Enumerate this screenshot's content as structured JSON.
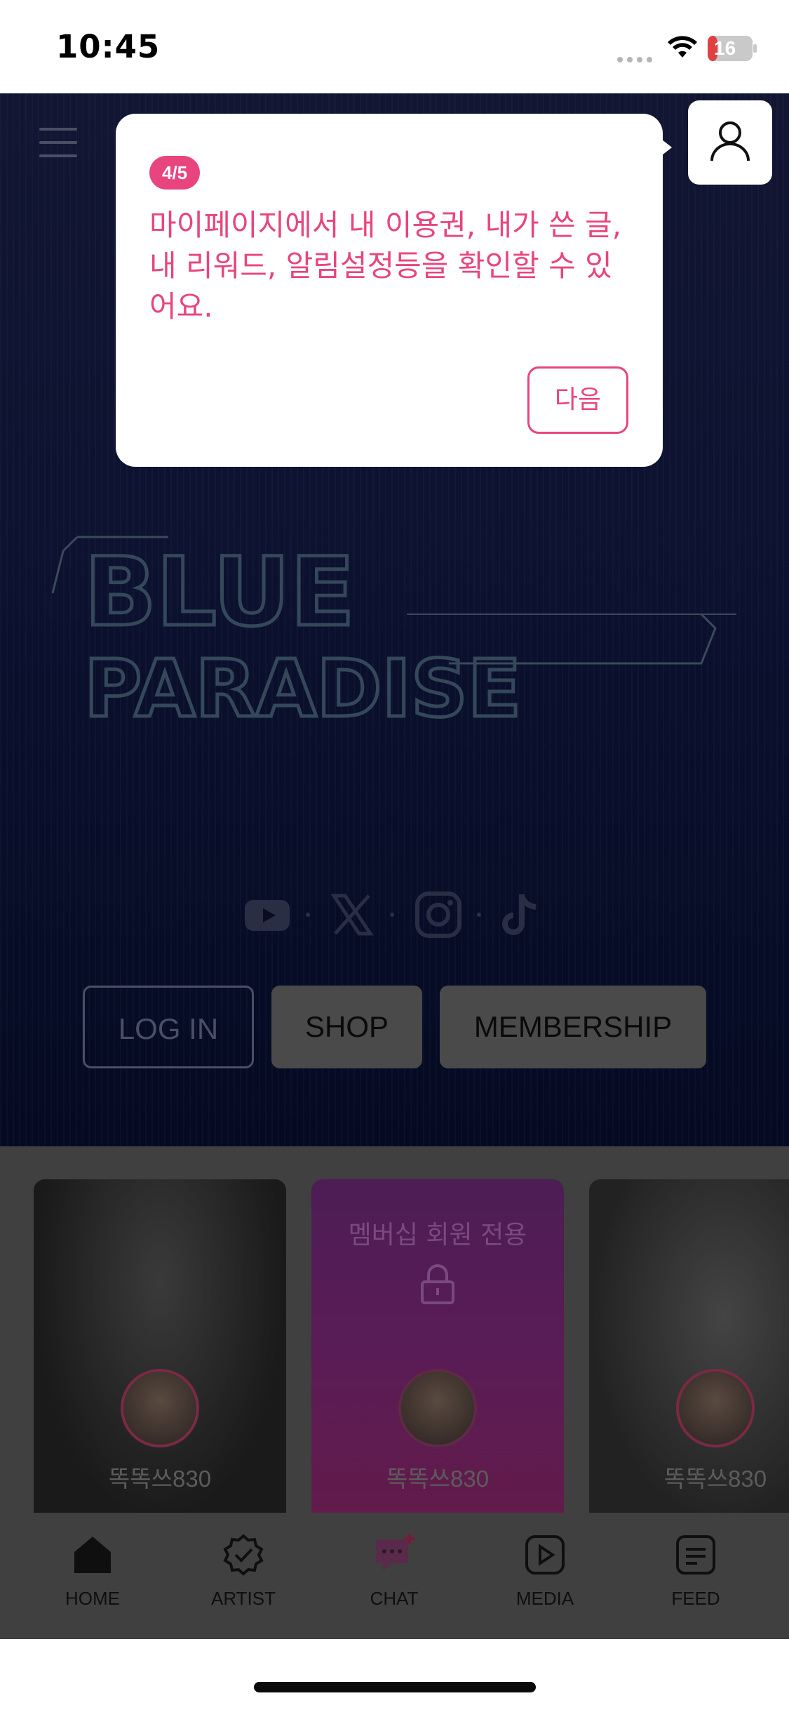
{
  "status_bar": {
    "time": "10:45",
    "battery": "16"
  },
  "tooltip": {
    "step": "4/5",
    "message": "마이페이지에서 내 이용권, 내가 쓴 글, 내 리워드, 알림설정등을 확인할 수 있어요.",
    "next_label": "다음"
  },
  "hero": {
    "logo_line1": "BLUE",
    "logo_line2": "PARADISE",
    "social_icons": [
      "youtube-icon",
      "x-icon",
      "instagram-icon",
      "tiktok-icon"
    ],
    "buttons": {
      "login": "LOG IN",
      "shop": "SHOP",
      "membership": "MEMBERSHIP"
    }
  },
  "cards": [
    {
      "name": "똑똑쓰830",
      "locked": false
    },
    {
      "name": "똑똑쓰830",
      "locked": true,
      "lock_label": "멤버십 회원 전용"
    },
    {
      "name": "똑똑쓰830",
      "locked": false
    }
  ],
  "tabs": [
    {
      "label": "HOME",
      "icon": "home-icon"
    },
    {
      "label": "ARTIST",
      "icon": "verified-badge-icon"
    },
    {
      "label": "CHAT",
      "icon": "chat-icon"
    },
    {
      "label": "MEDIA",
      "icon": "play-icon"
    },
    {
      "label": "FEED",
      "icon": "feed-icon"
    }
  ],
  "colors": {
    "accent": "#e8457e",
    "hero_bg": "#0c1230",
    "dim_gray": "#404040"
  }
}
